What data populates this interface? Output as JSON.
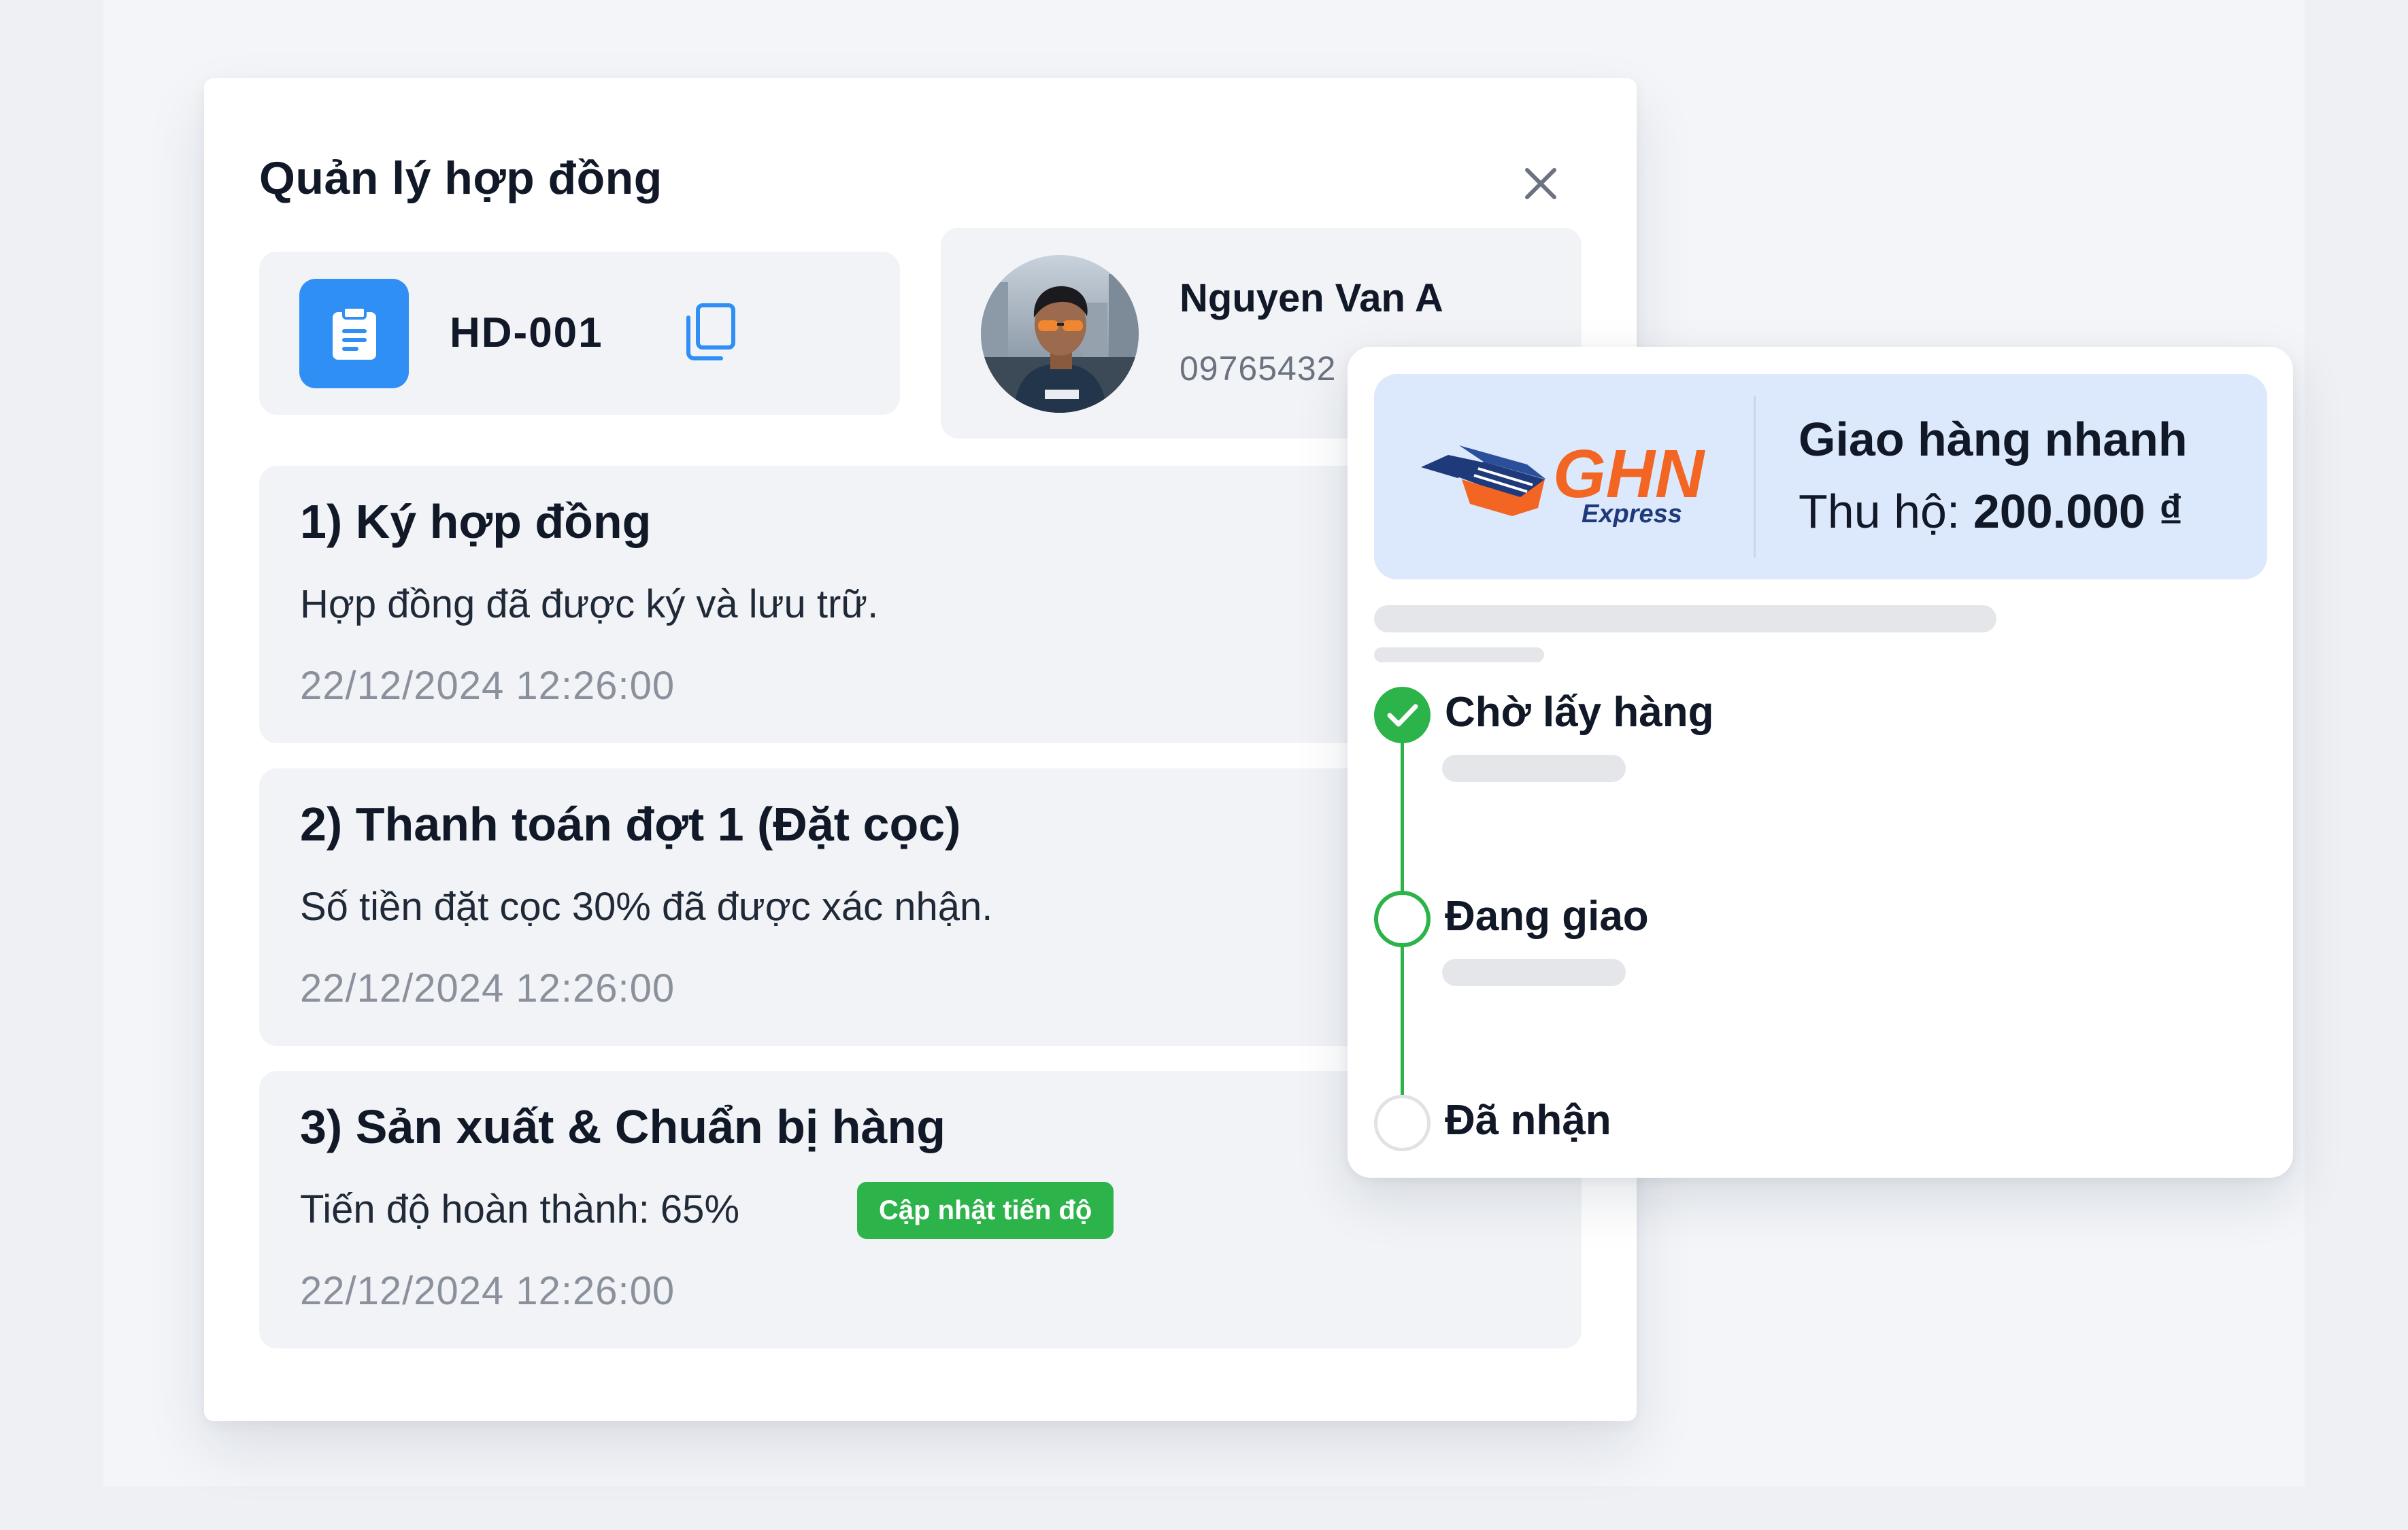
{
  "modal": {
    "title": "Quản lý hợp đồng"
  },
  "contract": {
    "code": "HD-001"
  },
  "customer": {
    "name": "Nguyen Van A",
    "phone": "09765432"
  },
  "steps": [
    {
      "title": "1) Ký hợp đồng",
      "description": "Hợp đồng đã được ký và lưu trữ.",
      "time": "22/12/2024 12:26:00"
    },
    {
      "title": "2) Thanh toán đợt 1 (Đặt cọc)",
      "description": "Số tiền đặt cọc 30% đã được xác nhận.",
      "time": "22/12/2024 12:26:00"
    },
    {
      "title": "3) Sản xuất & Chuẩn bị hàng",
      "description": "Tiến độ hoàn thành: 65%",
      "time": "22/12/2024 12:26:00",
      "action_label": "Cập nhật tiến độ"
    }
  ],
  "shipping": {
    "carrier_logo_text": "GHN",
    "carrier_logo_subtext": "Express",
    "carrier_name": "Giao hàng nhanh",
    "cod_label": "Thu hộ: ",
    "cod_amount": "200.000 ₫",
    "timeline": [
      {
        "label": "Chờ lấy hàng",
        "status": "done"
      },
      {
        "label": "Đang giao",
        "status": "active"
      },
      {
        "label": "Đã nhận",
        "status": "pending"
      }
    ]
  },
  "colors": {
    "primary": "#2f8ff5",
    "success": "#2cb34a",
    "ghn_orange": "#f26522",
    "ghn_navy": "#1f3a7a"
  }
}
